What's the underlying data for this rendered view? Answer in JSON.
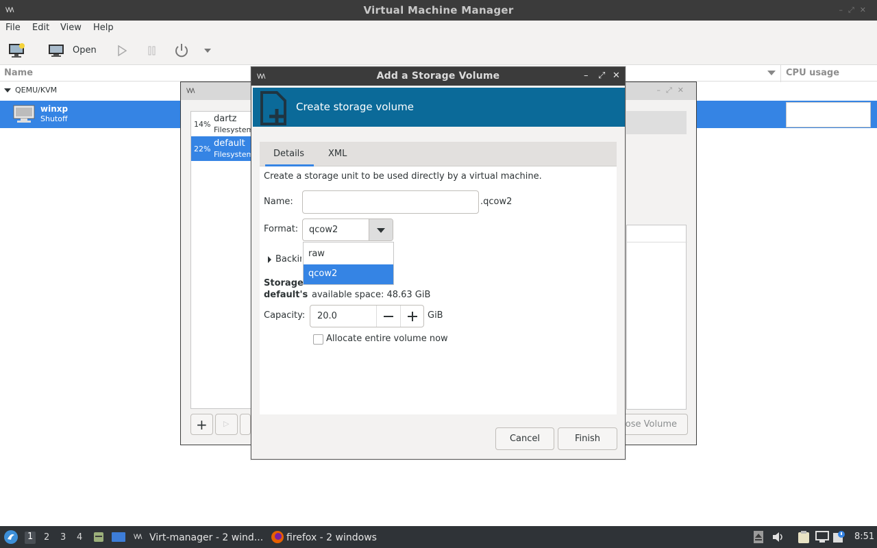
{
  "main_window": {
    "title": "Virtual Machine Manager",
    "menu": [
      "File",
      "Edit",
      "View",
      "Help"
    ],
    "toolbar": {
      "open_label": "Open"
    },
    "list_header": {
      "name": "Name",
      "cpu": "CPU usage"
    },
    "connection": "QEMU/KVM",
    "vm": {
      "name": "winxp",
      "status": "Shutoff"
    }
  },
  "storage_window": {
    "pools": [
      {
        "percent": "14%",
        "name": "dartz",
        "type": "Filesystem"
      },
      {
        "percent": "22%",
        "name": "default",
        "type": "Filesystem"
      }
    ],
    "close_volume_label": "Close Volume"
  },
  "dialog": {
    "title": "Add a Storage Volume",
    "banner": "Create storage volume",
    "tabs": [
      "Details",
      "XML"
    ],
    "description": "Create a storage unit to be used directly by a virtual machine.",
    "name_label": "Name:",
    "name_value": "",
    "name_suffix": ".qcow2",
    "format_label": "Format:",
    "format_value": "qcow2",
    "format_options": [
      "raw",
      "qcow2"
    ],
    "format_selected": "qcow2",
    "backing_label": "Backing store",
    "storage_heading": "Storage Volume Quota",
    "pool_name": "default's",
    "available": "available space: 48.63 GiB",
    "capacity_label": "Capacity:",
    "capacity_value": "20.0",
    "capacity_unit": "GiB",
    "allocate_label": "Allocate entire volume now",
    "allocate_checked": false,
    "cancel": "Cancel",
    "finish": "Finish"
  },
  "taskbar": {
    "workspaces": [
      "1",
      "2",
      "3",
      "4"
    ],
    "current_workspace": "1",
    "tasks": [
      "Virt-manager - 2 wind...",
      "firefox - 2 windows"
    ],
    "clock": "8:51"
  },
  "colors": {
    "selection": "#3584e4",
    "banner": "#0b6a99",
    "titlebar": "#3b3b3b",
    "taskbar": "#2f3337"
  }
}
